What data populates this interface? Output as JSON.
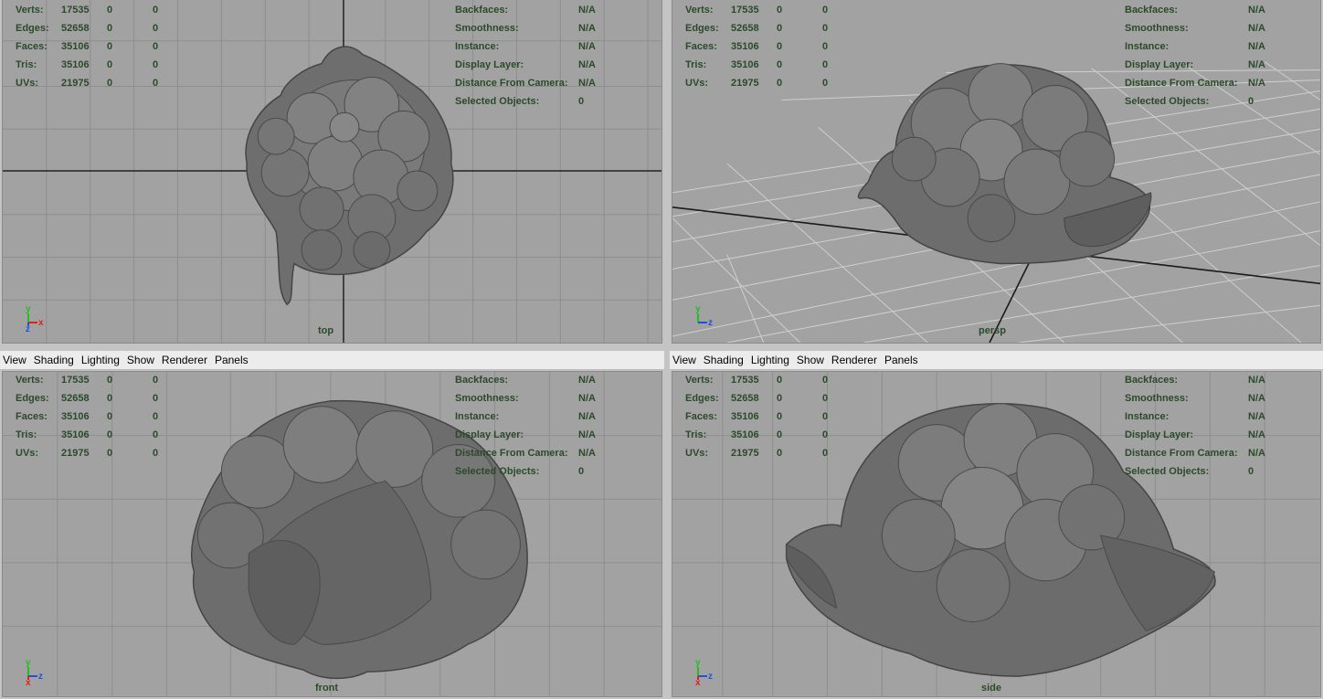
{
  "menu": [
    "View",
    "Shading",
    "Lighting",
    "Show",
    "Renderer",
    "Panels"
  ],
  "hud_left": [
    {
      "label": "Verts:",
      "v1": "17535",
      "v2": "0",
      "v3": "0"
    },
    {
      "label": "Edges:",
      "v1": "52658",
      "v2": "0",
      "v3": "0"
    },
    {
      "label": "Faces:",
      "v1": "35106",
      "v2": "0",
      "v3": "0"
    },
    {
      "label": "Tris:",
      "v1": "35106",
      "v2": "0",
      "v3": "0"
    },
    {
      "label": "UVs:",
      "v1": "21975",
      "v2": "0",
      "v3": "0"
    }
  ],
  "hud_right": [
    {
      "label": "Backfaces:",
      "value": "N/A"
    },
    {
      "label": "Smoothness:",
      "value": "N/A"
    },
    {
      "label": "Instance:",
      "value": "N/A"
    },
    {
      "label": "Display Layer:",
      "value": "N/A"
    },
    {
      "label": "Distance From Camera:",
      "value": "N/A"
    },
    {
      "label": "Selected Objects:",
      "value": "0"
    }
  ],
  "panels": [
    {
      "camera": "top",
      "axis": [
        "y",
        "x",
        "z"
      ],
      "menubar": false
    },
    {
      "camera": "persp",
      "axis": [
        "y",
        "z"
      ],
      "menubar": false
    },
    {
      "camera": "front",
      "axis": [
        "y",
        "z",
        "x"
      ],
      "menubar": true
    },
    {
      "camera": "side",
      "axis": [
        "y",
        "z",
        "x"
      ],
      "menubar": true
    }
  ],
  "colors": {
    "viewport_bg": "#a2a2a2",
    "grid": "#8c8c8c",
    "hud_text": "#2a4a2a",
    "axis_x": "#e02020",
    "axis_y": "#20c020",
    "axis_z": "#2050e0"
  }
}
